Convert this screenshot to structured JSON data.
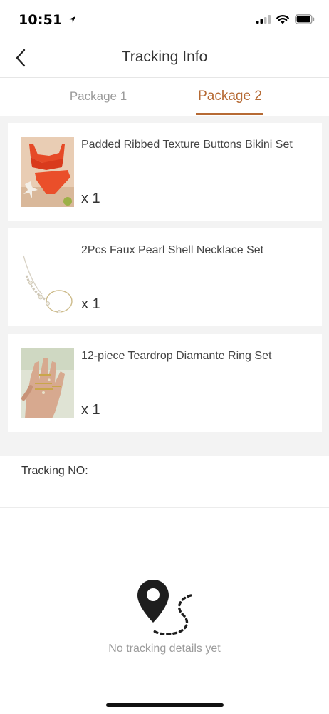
{
  "status_bar": {
    "time": "10:51",
    "icons": [
      "location-arrow-icon",
      "signal-icon",
      "wifi-icon",
      "battery-icon"
    ]
  },
  "header": {
    "title": "Tracking Info",
    "back_icon": "chevron-left-icon"
  },
  "tabs": [
    {
      "label": "Package 1",
      "active": false
    },
    {
      "label": "Package 2",
      "active": true
    }
  ],
  "accent_color": "#b66a34",
  "items": [
    {
      "title": "Padded Ribbed Texture Buttons Bikini Set",
      "quantity": "x 1",
      "image": "red-bikini-photo"
    },
    {
      "title": "2Pcs Faux Pearl Shell Necklace Set",
      "quantity": "x 1",
      "image": "shell-necklace-photo"
    },
    {
      "title": "12-piece Teardrop Diamante Ring Set",
      "quantity": "x 1",
      "image": "ring-set-photo"
    }
  ],
  "tracking": {
    "label": "Tracking NO:",
    "number": ""
  },
  "empty_state": {
    "icon": "map-pin-route-icon",
    "message": "No tracking details yet"
  }
}
